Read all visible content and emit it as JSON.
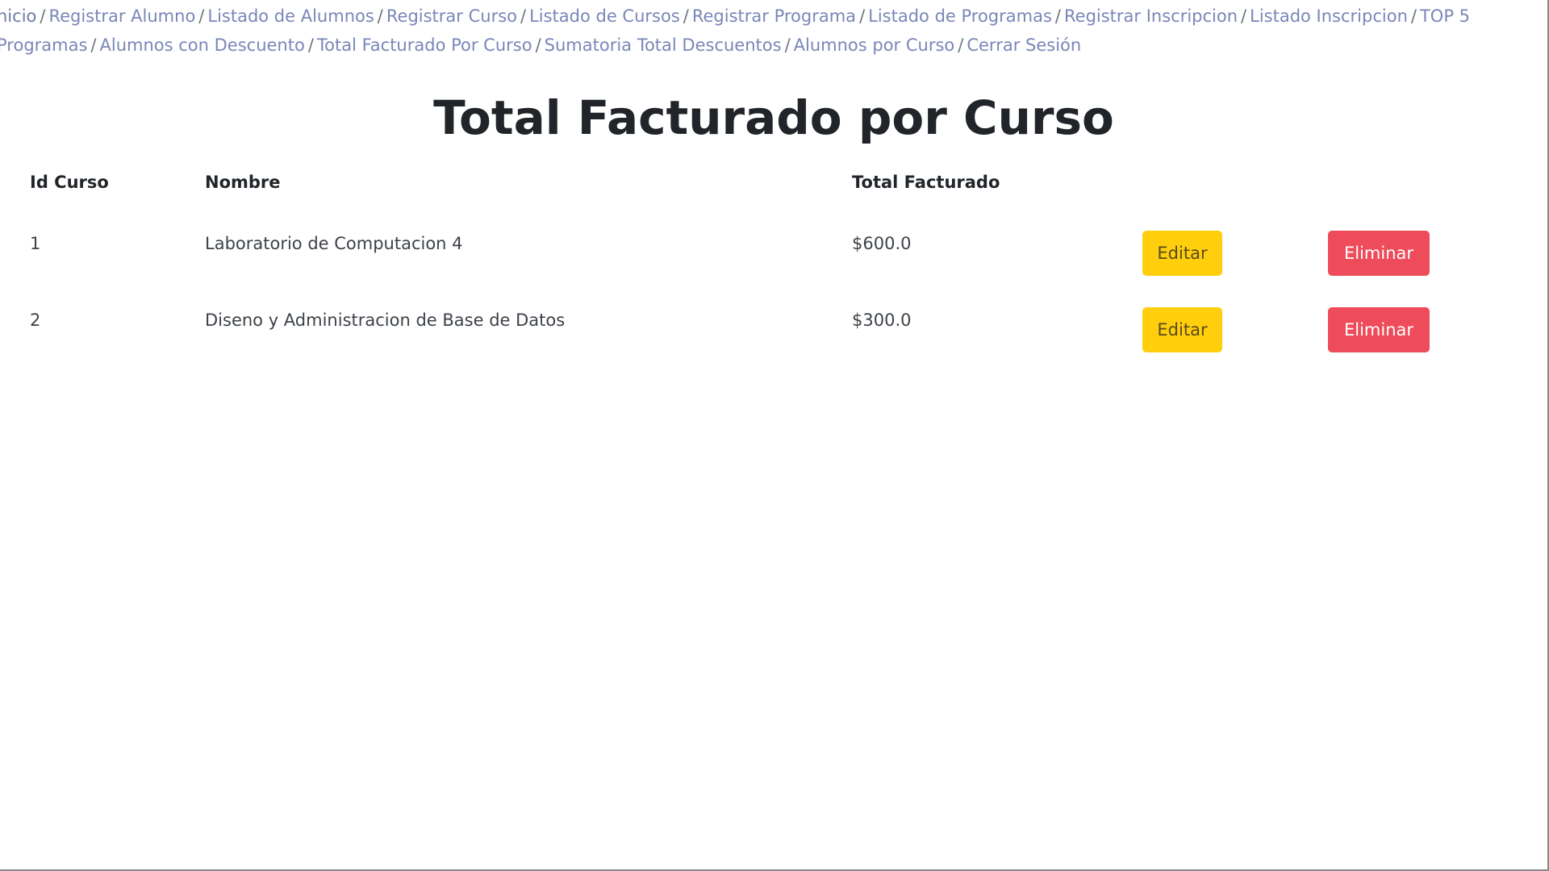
{
  "nav": {
    "items": [
      "nicio",
      "Registrar Alumno",
      "Listado de Alumnos",
      "Registrar Curso",
      "Listado de Cursos",
      "Registrar Programa",
      "Listado de Programas",
      "Registrar Inscripcion",
      "Listado Inscripcion",
      "TOP 5 Programas",
      "Alumnos con Descuento",
      "Total Facturado Por Curso",
      "Sumatoria Total Descuentos",
      "Alumnos por Curso",
      "Cerrar Sesión"
    ],
    "separator": "/"
  },
  "page": {
    "title": "Total Facturado por Curso"
  },
  "table": {
    "headers": {
      "id": "Id Curso",
      "name": "Nombre",
      "total": "Total Facturado"
    },
    "rows": [
      {
        "id": "1",
        "name": "Laboratorio de Computacion 4",
        "total": "$600.0",
        "edit": "Editar",
        "delete": "Eliminar"
      },
      {
        "id": "2",
        "name": "Diseno y Administracion de Base de Datos",
        "total": "$300.0",
        "edit": "Editar",
        "delete": "Eliminar"
      }
    ]
  },
  "colors": {
    "link": "#7a86b8",
    "edit_button": "#ffcf0d",
    "delete_button": "#ee4b5b"
  }
}
